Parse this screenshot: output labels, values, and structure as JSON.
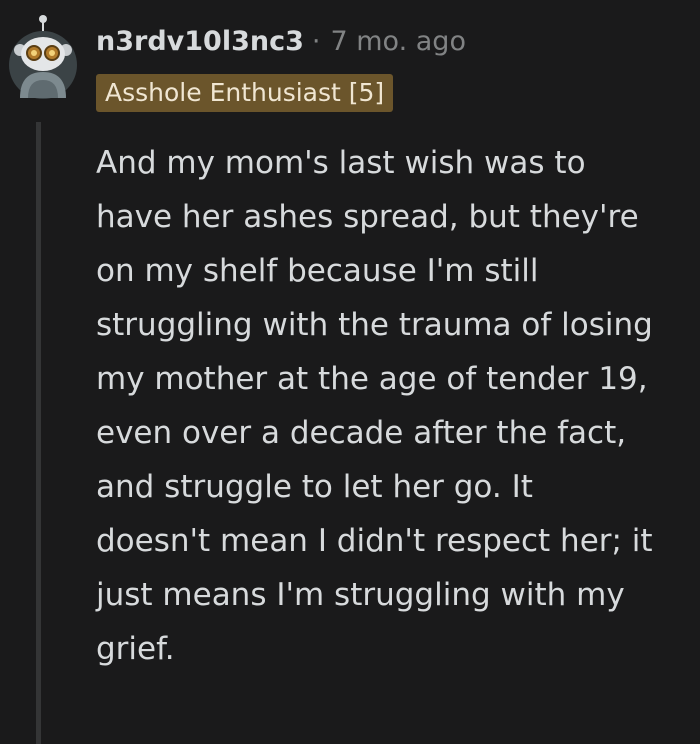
{
  "comment": {
    "author": "n3rdv10l3nc3",
    "separator": "·",
    "timestamp": "7 mo. ago",
    "flair": "Asshole Enthusiast [5]",
    "body": "And my mom's last wish was to have her ashes spread, but they're on my shelf because I'm still struggling with the trauma of losing my mother at the age of tender 19, even over a decade after the fact, and struggle to let her go. It doesn't mean I didn't respect her; it just means I'm struggling with my grief."
  },
  "icons": {
    "avatar": "snoo-avatar-icon"
  },
  "colors": {
    "background": "#1a1a1b",
    "text": "#d7dadc",
    "muted": "#818384",
    "flair_bg": "#6b552b",
    "thread_line": "#343536"
  }
}
